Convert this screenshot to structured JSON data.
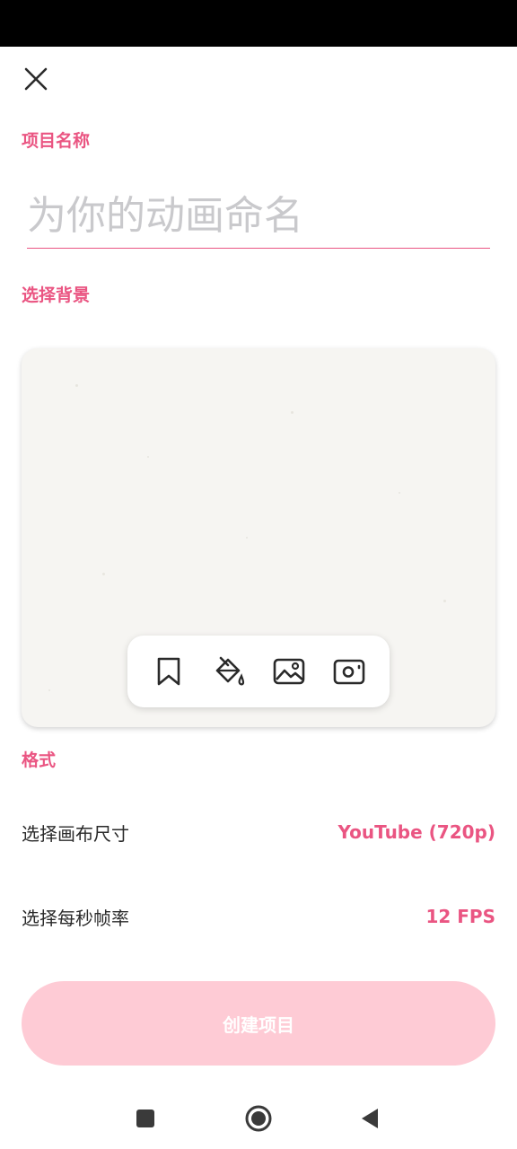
{
  "header": {
    "close_icon": "close-icon"
  },
  "project_name": {
    "label": "项目名称",
    "placeholder": "为你的动画命名",
    "value": ""
  },
  "background": {
    "label": "选择背景",
    "tools": [
      {
        "icon": "bookmark-icon"
      },
      {
        "icon": "paint-bucket-icon"
      },
      {
        "icon": "image-icon"
      },
      {
        "icon": "camera-icon"
      }
    ]
  },
  "format": {
    "label": "格式",
    "canvas_size": {
      "label": "选择画布尺寸",
      "value": "YouTube (720p)"
    },
    "frame_rate": {
      "label": "选择每秒帧率",
      "value": "12 FPS"
    }
  },
  "actions": {
    "create_label": "创建项目"
  },
  "colors": {
    "accent": "#ea5582",
    "button_disabled": "#fecbd5",
    "card_bg": "#f6f5f2"
  },
  "system_nav": {
    "recent": "square-icon",
    "home": "circle-icon",
    "back": "triangle-back-icon"
  }
}
